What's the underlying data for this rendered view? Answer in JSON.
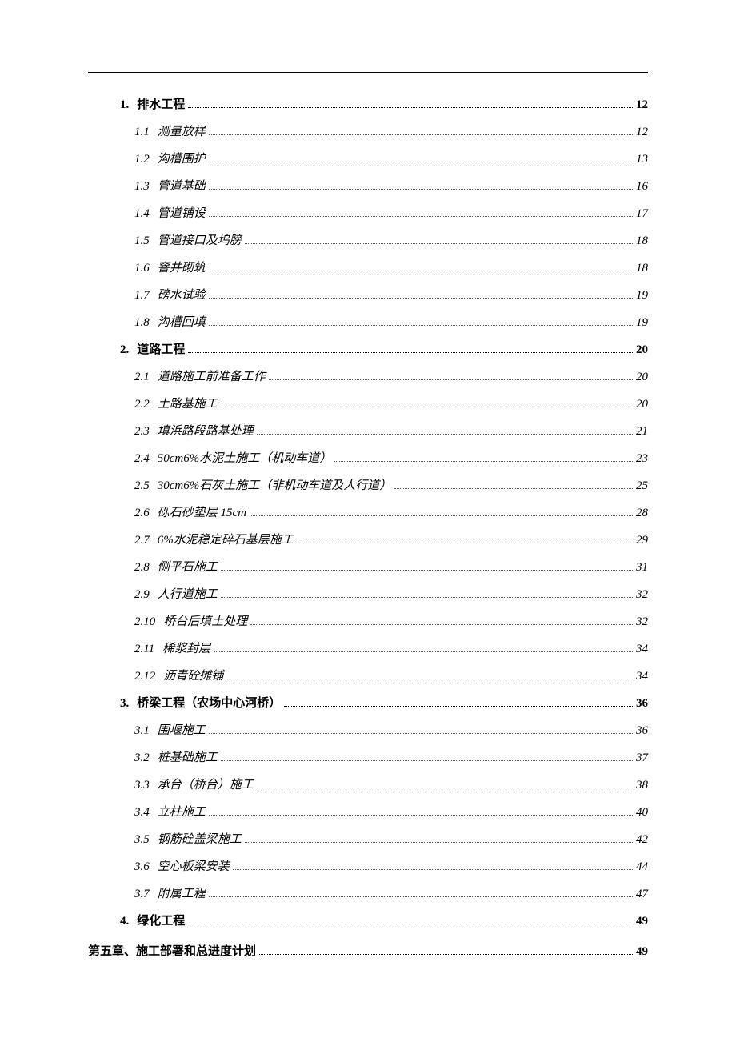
{
  "toc": [
    {
      "level": "level-1",
      "num": "1.",
      "title": "排水工程",
      "page": "12"
    },
    {
      "level": "level-2",
      "num": "1.1",
      "title": "测量放样",
      "page": "12"
    },
    {
      "level": "level-2",
      "num": "1.2",
      "title": "沟槽围护",
      "page": "13"
    },
    {
      "level": "level-2",
      "num": "1.3",
      "title": "管道基础",
      "page": "16"
    },
    {
      "level": "level-2",
      "num": "1.4",
      "title": "管道铺设",
      "page": "17"
    },
    {
      "level": "level-2",
      "num": "1.5",
      "title": "管道接口及坞膀",
      "page": "18"
    },
    {
      "level": "level-2",
      "num": "1.6",
      "title": "窨井砌筑",
      "page": "18"
    },
    {
      "level": "level-2",
      "num": "1.7",
      "title": "磅水试验",
      "page": "19"
    },
    {
      "level": "level-2",
      "num": "1.8",
      "title": "沟槽回填",
      "page": "19"
    },
    {
      "level": "level-1",
      "num": "2.",
      "title": "道路工程",
      "page": "20"
    },
    {
      "level": "level-2",
      "num": "2.1",
      "title": "道路施工前准备工作",
      "page": "20"
    },
    {
      "level": "level-2",
      "num": "2.2",
      "title": "土路基施工",
      "page": "20"
    },
    {
      "level": "level-2",
      "num": "2.3",
      "title": "填浜路段路基处理",
      "page": "21"
    },
    {
      "level": "level-2",
      "num": "2.4",
      "title": "50cm6%水泥土施工（机动车道）",
      "page": "23"
    },
    {
      "level": "level-2",
      "num": "2.5",
      "title": "30cm6%石灰土施工（非机动车道及人行道）",
      "page": "25"
    },
    {
      "level": "level-2",
      "num": "2.6",
      "title": "砾石砂垫层 15cm",
      "page": "28"
    },
    {
      "level": "level-2",
      "num": "2.7",
      "title": "6%水泥稳定碎石基层施工",
      "page": "29"
    },
    {
      "level": "level-2",
      "num": "2.8",
      "title": "侧平石施工",
      "page": "31"
    },
    {
      "level": "level-2",
      "num": "2.9",
      "title": "人行道施工",
      "page": "32"
    },
    {
      "level": "level-2",
      "num": "2.10",
      "title": "桥台后填土处理",
      "page": "32"
    },
    {
      "level": "level-2",
      "num": "2.11",
      "title": "稀浆封层",
      "page": "34"
    },
    {
      "level": "level-2",
      "num": "2.12",
      "title": "沥青砼摊铺",
      "page": "34"
    },
    {
      "level": "level-1",
      "num": "3.",
      "title": "桥梁工程（农场中心河桥）",
      "page": "36"
    },
    {
      "level": "level-2",
      "num": "3.1",
      "title": "围堰施工",
      "page": "36"
    },
    {
      "level": "level-2",
      "num": "3.2",
      "title": "桩基础施工",
      "page": "37"
    },
    {
      "level": "level-2",
      "num": "3.3",
      "title": "承台（桥台）施工",
      "page": "38"
    },
    {
      "level": "level-2",
      "num": "3.4",
      "title": "立柱施工",
      "page": "40"
    },
    {
      "level": "level-2",
      "num": "3.5",
      "title": "钢筋砼盖梁施工",
      "page": "42"
    },
    {
      "level": "level-2",
      "num": "3.6",
      "title": "空心板梁安装",
      "page": "44"
    },
    {
      "level": "level-2",
      "num": "3.7",
      "title": "附属工程",
      "page": "47"
    },
    {
      "level": "level-1",
      "num": "4.",
      "title": "绿化工程",
      "page": "49"
    },
    {
      "level": "chapter",
      "num": "",
      "title": "第五章、施工部署和总进度计划",
      "page": "49"
    }
  ]
}
